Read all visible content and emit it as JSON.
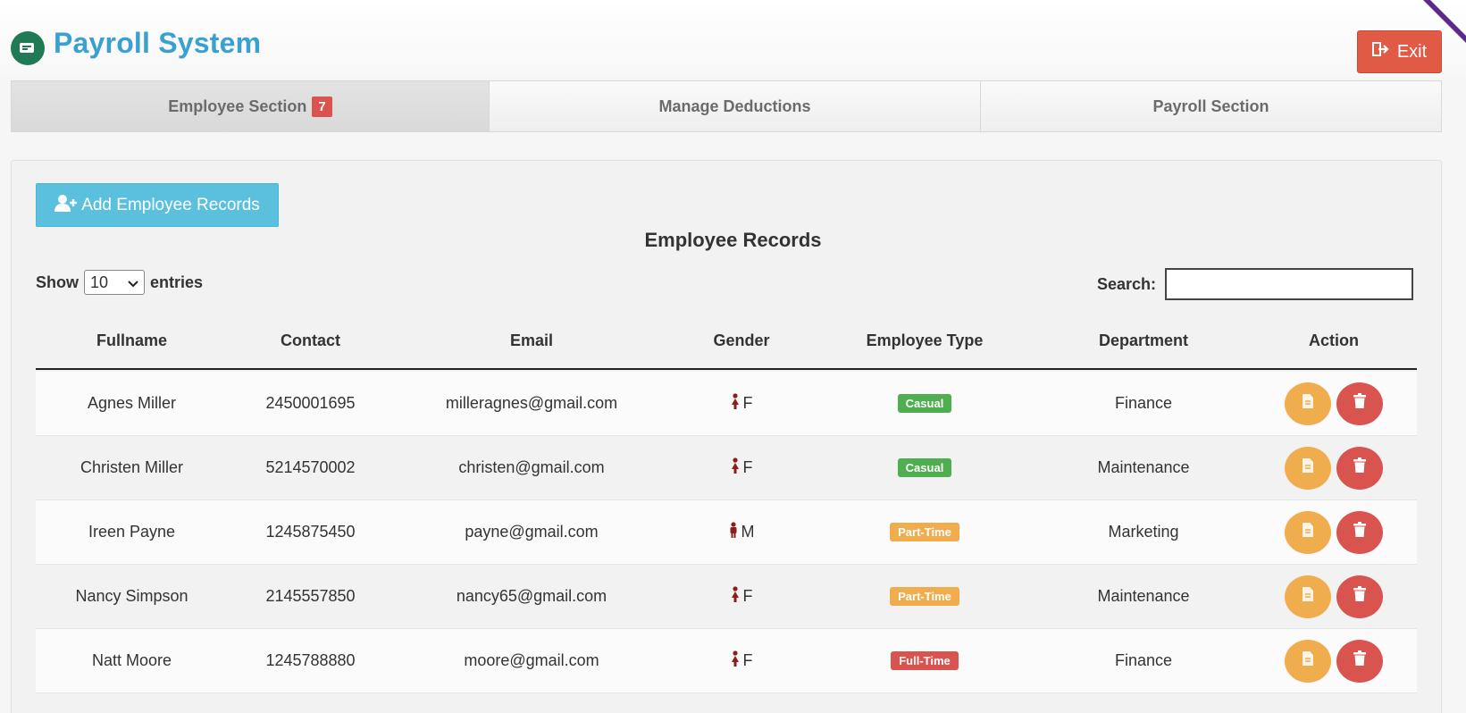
{
  "header": {
    "title": "Payroll System",
    "exit_label": "Exit",
    "logo_icon": "payroll-logo-icon"
  },
  "tabs": [
    {
      "label": "Employee Section",
      "badge": "7",
      "active": true
    },
    {
      "label": "Manage Deductions",
      "active": false
    },
    {
      "label": "Payroll Section",
      "active": false
    }
  ],
  "toolbar": {
    "add_label": "Add Employee Records",
    "add_icon": "user-plus-icon"
  },
  "section_title": "Employee Records",
  "entries": {
    "show_label": "Show",
    "value": "10",
    "suffix_label": "entries"
  },
  "search": {
    "label": "Search:",
    "value": ""
  },
  "table": {
    "columns": [
      "Fullname",
      "Contact",
      "Email",
      "Gender",
      "Employee Type",
      "Department",
      "Action"
    ],
    "rows": [
      {
        "fullname": "Agnes Miller",
        "contact": "2450001695",
        "email": "milleragnes@gmail.com",
        "gender": "F",
        "type": "Casual",
        "department": "Finance"
      },
      {
        "fullname": "Christen Miller",
        "contact": "5214570002",
        "email": "christen@gmail.com",
        "gender": "F",
        "type": "Casual",
        "department": "Maintenance"
      },
      {
        "fullname": "Ireen Payne",
        "contact": "1245875450",
        "email": "payne@gmail.com",
        "gender": "M",
        "type": "Part-Time",
        "department": "Marketing"
      },
      {
        "fullname": "Nancy Simpson",
        "contact": "2145557850",
        "email": "nancy65@gmail.com",
        "gender": "F",
        "type": "Part-Time",
        "department": "Maintenance"
      },
      {
        "fullname": "Natt Moore",
        "contact": "1245788880",
        "email": "moore@gmail.com",
        "gender": "F",
        "type": "Full-Time",
        "department": "Finance"
      }
    ]
  },
  "colors": {
    "title": "#3aa0cf",
    "exit": "#e05a46",
    "casual": "#4fae4f",
    "part_time": "#f0ad4e",
    "full_time": "#d9534f",
    "edit": "#f0ad4e",
    "delete": "#d9534f"
  }
}
